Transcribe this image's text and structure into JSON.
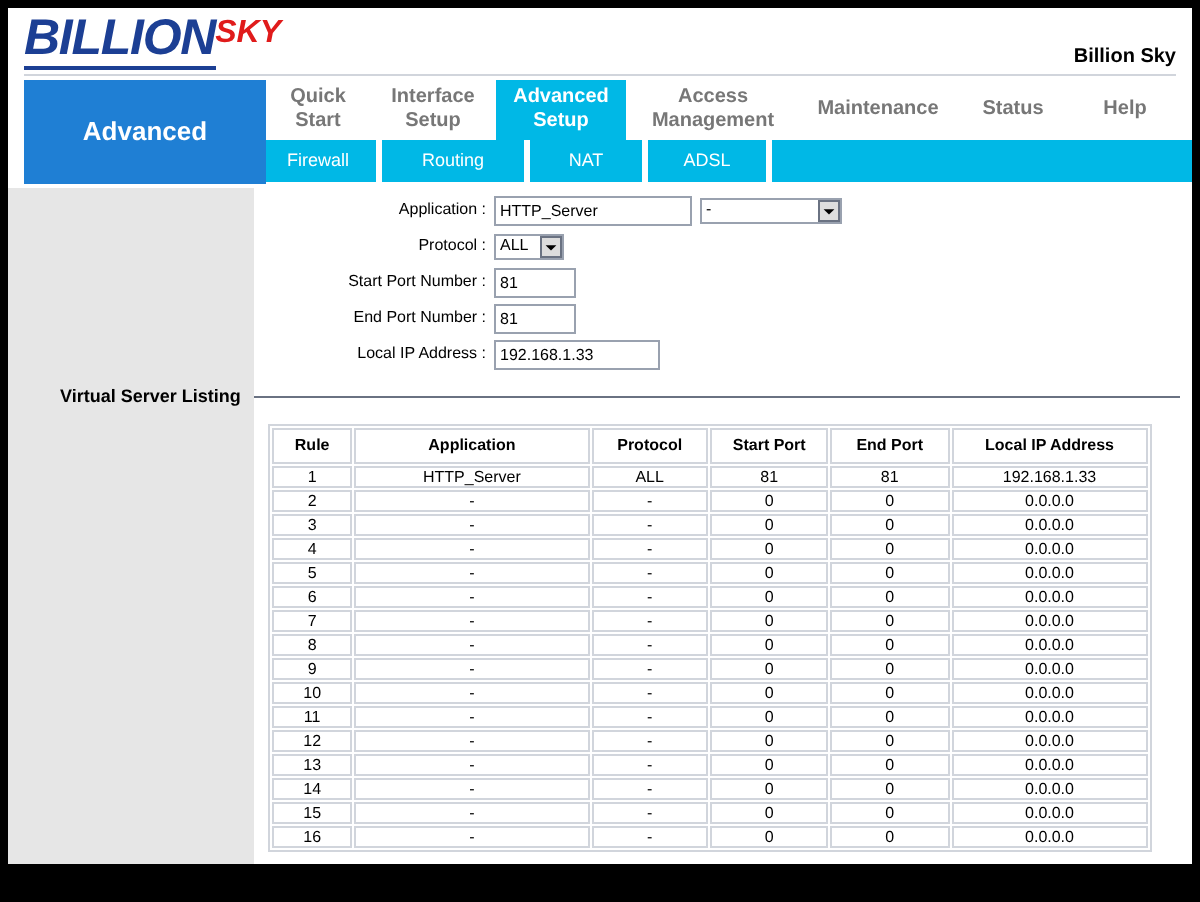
{
  "logo": {
    "name": "BILLION",
    "suffix": "SKY"
  },
  "device_name": "Billion Sky",
  "section": "Advanced",
  "tabs": [
    {
      "label": "Quick Start",
      "selected": false
    },
    {
      "label": "Interface Setup",
      "selected": false
    },
    {
      "label": "Advanced Setup",
      "selected": true
    },
    {
      "label": "Access Management",
      "selected": false
    },
    {
      "label": "Maintenance",
      "selected": false
    },
    {
      "label": "Status",
      "selected": false
    },
    {
      "label": "Help",
      "selected": false
    }
  ],
  "subtabs": [
    {
      "label": "Firewall",
      "selected": false
    },
    {
      "label": "Routing",
      "selected": false
    },
    {
      "label": "NAT",
      "selected": false
    },
    {
      "label": "ADSL",
      "selected": false
    }
  ],
  "form": {
    "application": {
      "label": "Application :",
      "value": "HTTP_Server",
      "preset": "-"
    },
    "protocol": {
      "label": "Protocol :",
      "value": "ALL"
    },
    "start_port": {
      "label": "Start Port Number :",
      "value": "81"
    },
    "end_port": {
      "label": "End Port Number :",
      "value": "81"
    },
    "local_ip": {
      "label": "Local IP Address :",
      "value": "192.168.1.33"
    }
  },
  "listing": {
    "title": "Virtual Server Listing",
    "columns": [
      "Rule",
      "Application",
      "Protocol",
      "Start Port",
      "End Port",
      "Local IP Address"
    ],
    "rows": [
      [
        "1",
        "HTTP_Server",
        "ALL",
        "81",
        "81",
        "192.168.1.33"
      ],
      [
        "2",
        "-",
        "-",
        "0",
        "0",
        "0.0.0.0"
      ],
      [
        "3",
        "-",
        "-",
        "0",
        "0",
        "0.0.0.0"
      ],
      [
        "4",
        "-",
        "-",
        "0",
        "0",
        "0.0.0.0"
      ],
      [
        "5",
        "-",
        "-",
        "0",
        "0",
        "0.0.0.0"
      ],
      [
        "6",
        "-",
        "-",
        "0",
        "0",
        "0.0.0.0"
      ],
      [
        "7",
        "-",
        "-",
        "0",
        "0",
        "0.0.0.0"
      ],
      [
        "8",
        "-",
        "-",
        "0",
        "0",
        "0.0.0.0"
      ],
      [
        "9",
        "-",
        "-",
        "0",
        "0",
        "0.0.0.0"
      ],
      [
        "10",
        "-",
        "-",
        "0",
        "0",
        "0.0.0.0"
      ],
      [
        "11",
        "-",
        "-",
        "0",
        "0",
        "0.0.0.0"
      ],
      [
        "12",
        "-",
        "-",
        "0",
        "0",
        "0.0.0.0"
      ],
      [
        "13",
        "-",
        "-",
        "0",
        "0",
        "0.0.0.0"
      ],
      [
        "14",
        "-",
        "-",
        "0",
        "0",
        "0.0.0.0"
      ],
      [
        "15",
        "-",
        "-",
        "0",
        "0",
        "0.0.0.0"
      ],
      [
        "16",
        "-",
        "-",
        "0",
        "0",
        "0.0.0.0"
      ]
    ]
  }
}
